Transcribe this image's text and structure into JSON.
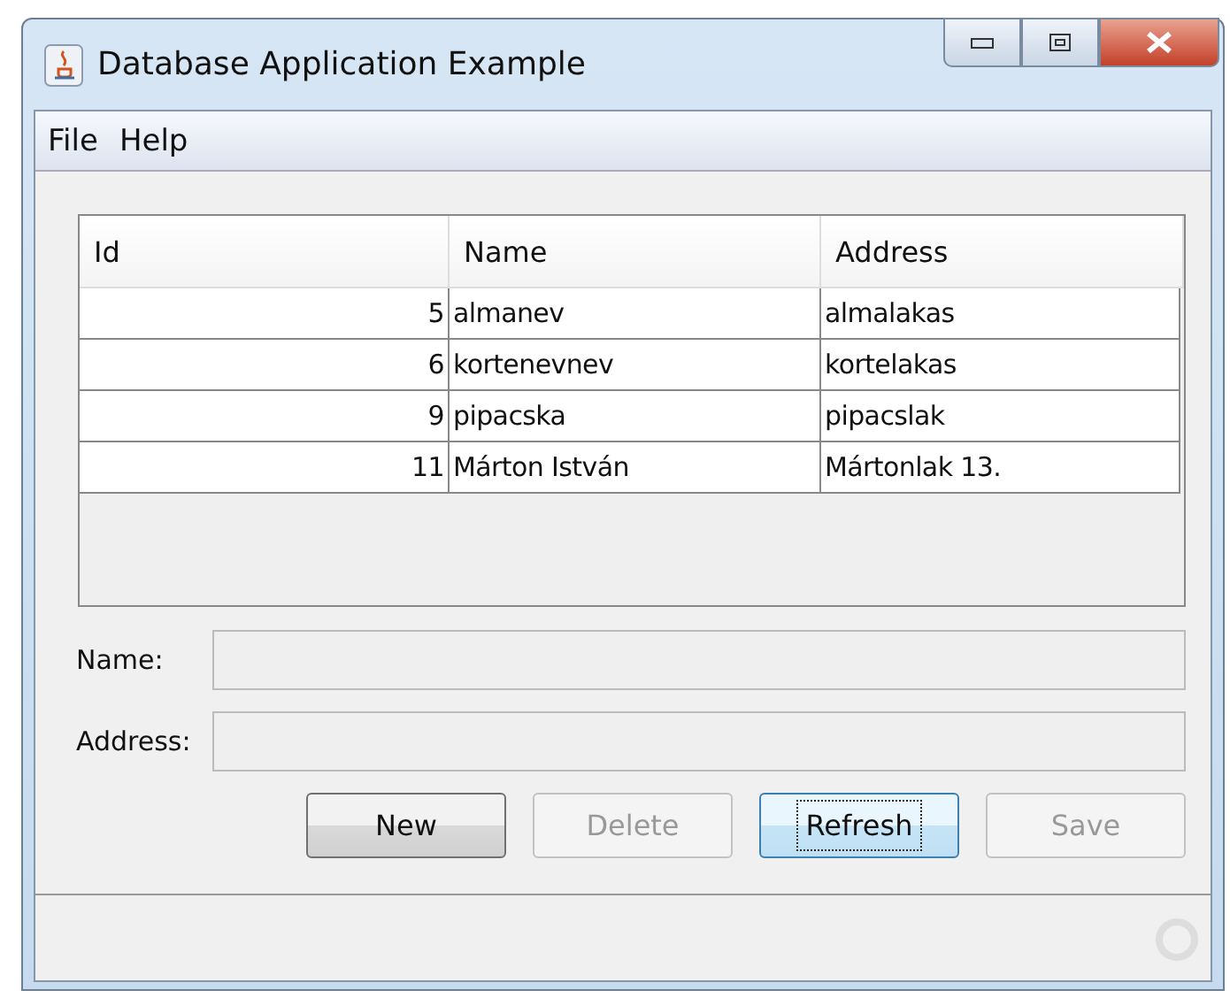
{
  "window": {
    "title": "Database Application Example"
  },
  "menu": [
    {
      "label": "File"
    },
    {
      "label": "Help"
    }
  ],
  "table": {
    "columns": [
      "Id",
      "Name",
      "Address"
    ],
    "rows": [
      [
        "5",
        "almanev",
        "almalakas"
      ],
      [
        "6",
        "kortenevnev",
        "kortelakas"
      ],
      [
        "9",
        "pipacska",
        "pipacslak"
      ],
      [
        "11",
        "Márton István",
        "Mártonlak 13."
      ]
    ]
  },
  "form": [
    {
      "label": "Name:",
      "disabled": true
    },
    {
      "label": "Address:",
      "disabled": true
    }
  ],
  "buttons": [
    {
      "label": "New",
      "disabled": false,
      "focused": false
    },
    {
      "label": "Delete",
      "disabled": true,
      "focused": false
    },
    {
      "label": "Refresh",
      "disabled": false,
      "focused": true
    },
    {
      "label": "Save",
      "disabled": true,
      "focused": false
    }
  ]
}
